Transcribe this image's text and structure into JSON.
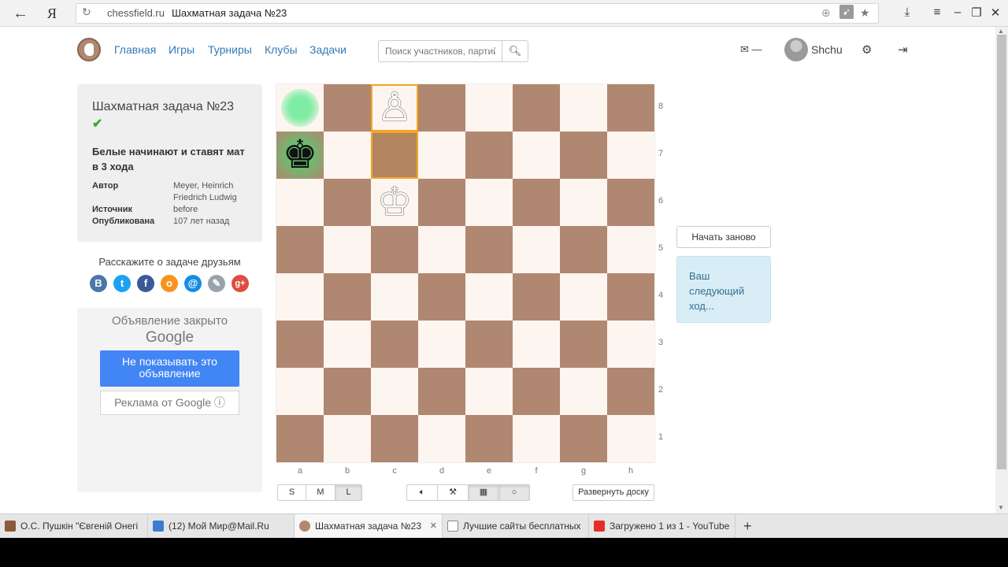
{
  "browser": {
    "back_icon": "arrow-left-icon",
    "yandex_logo": "Я",
    "domain": "chessfield.ru",
    "page_title": "Шахматная задача №23"
  },
  "header": {
    "nav": [
      "Главная",
      "Игры",
      "Турниры",
      "Клубы",
      "Задачи"
    ],
    "search_placeholder": "Поиск участников, партий...",
    "mail_count": "—",
    "username": "Shchu"
  },
  "task": {
    "title": "Шахматная задача №23",
    "solved_icon": "check-icon",
    "description": "Белые начинают и ставят мат в 3 хода",
    "meta": [
      {
        "key": "Автор",
        "value": "Meyer, Heinrich Friedrich Ludwig"
      },
      {
        "key": "Источник",
        "value": "before"
      },
      {
        "key": "Опубликована",
        "value": "107 лет назад"
      }
    ]
  },
  "share": {
    "label": "Расскажите о задаче друзьям",
    "icons": [
      {
        "name": "vk-icon",
        "glyph": "B",
        "color": "#4a76a8"
      },
      {
        "name": "twitter-icon",
        "glyph": "t",
        "color": "#1da1f2"
      },
      {
        "name": "facebook-icon",
        "glyph": "f",
        "color": "#3b5998"
      },
      {
        "name": "odnoklassniki-icon",
        "glyph": "о",
        "color": "#f7931e"
      },
      {
        "name": "mailru-icon",
        "glyph": "@",
        "color": "#168de2"
      },
      {
        "name": "livejournal-icon",
        "glyph": "✎",
        "color": "#9aa3ab"
      },
      {
        "name": "googleplus-icon",
        "glyph": "g+",
        "color": "#dc4e41"
      }
    ]
  },
  "ad": {
    "closed": "Объявление закрыто",
    "google": "Google",
    "hide_button": "Не показывать это объявление",
    "ads_by": "Реклама от Google ⓘ"
  },
  "board": {
    "files": [
      "a",
      "b",
      "c",
      "d",
      "e",
      "f",
      "g",
      "h"
    ],
    "ranks": [
      "8",
      "7",
      "6",
      "5",
      "4",
      "3",
      "2",
      "1"
    ],
    "pieces": [
      {
        "square": "c8",
        "piece": "white-pawn-icon",
        "glyph": "♙",
        "side": "white"
      },
      {
        "square": "a7",
        "piece": "black-king-icon",
        "glyph": "♚",
        "side": "black"
      },
      {
        "square": "c6",
        "piece": "white-king-icon",
        "glyph": "♔",
        "side": "white"
      }
    ],
    "highlighted": [
      "c8",
      "c7"
    ],
    "hint": [
      "a8"
    ],
    "check": [
      "a7"
    ]
  },
  "controls": {
    "sizes": [
      {
        "label": "S",
        "active": false
      },
      {
        "label": "M",
        "active": false
      },
      {
        "label": "L",
        "active": true
      }
    ],
    "tools": [
      {
        "name": "sound-icon",
        "glyph": "🔈",
        "active": false
      },
      {
        "name": "wand-icon",
        "glyph": "⚒",
        "active": false
      },
      {
        "name": "grid-icon",
        "glyph": "▦",
        "active": true
      },
      {
        "name": "circle-icon",
        "glyph": "○",
        "active": true
      }
    ],
    "expand": "Развернуть доску"
  },
  "side": {
    "restart": "Начать заново",
    "next_move": "Ваш следующий ход..."
  },
  "taskbar": {
    "tabs": [
      {
        "label": "О.С. Пушкін \"Євгеній Онегі",
        "icon_color": "#8a5a3a",
        "active": false
      },
      {
        "label": "(12) Мой Мир@Mail.Ru",
        "icon_color": "#3b7bd4",
        "active": false
      },
      {
        "label": "Шахматная задача №23",
        "icon_color": "#b08770",
        "active": true
      },
      {
        "label": "Лучшие сайты бесплатных",
        "icon_color": "#888888",
        "active": false
      },
      {
        "label": "Загружено 1 из 1 - YouTube",
        "icon_color": "#e52d27",
        "active": false
      }
    ],
    "new_tab": "+"
  }
}
